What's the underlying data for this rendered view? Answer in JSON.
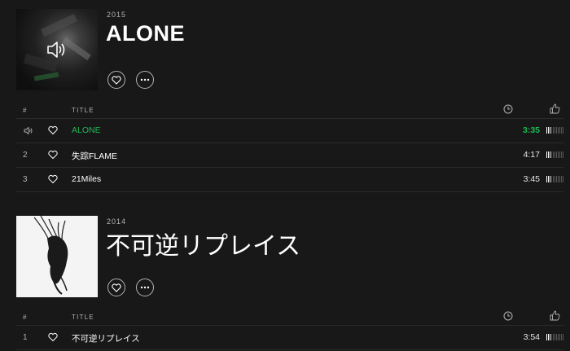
{
  "columns": {
    "num": "#",
    "title": "TITLE"
  },
  "albums": [
    {
      "year": "2015",
      "title": "ALONE",
      "cover_icon": "speaker-icon",
      "tracks": [
        {
          "num": "",
          "playing": true,
          "title": "ALONE",
          "duration": "3:35",
          "popularity": 0.35
        },
        {
          "num": "2",
          "playing": false,
          "title": "失踪FLAME",
          "duration": "4:17",
          "popularity": 0.35
        },
        {
          "num": "3",
          "playing": false,
          "title": "21Miles",
          "duration": "3:45",
          "popularity": 0.35
        }
      ]
    },
    {
      "year": "2014",
      "title": "不可逆リプレイス",
      "tracks": [
        {
          "num": "1",
          "playing": false,
          "title": "不可逆リプレイス",
          "duration": "3:54",
          "popularity": 0.35
        }
      ]
    }
  ],
  "colors": {
    "accent": "#1db954",
    "background": "#181818",
    "muted": "#b3b3b3"
  }
}
